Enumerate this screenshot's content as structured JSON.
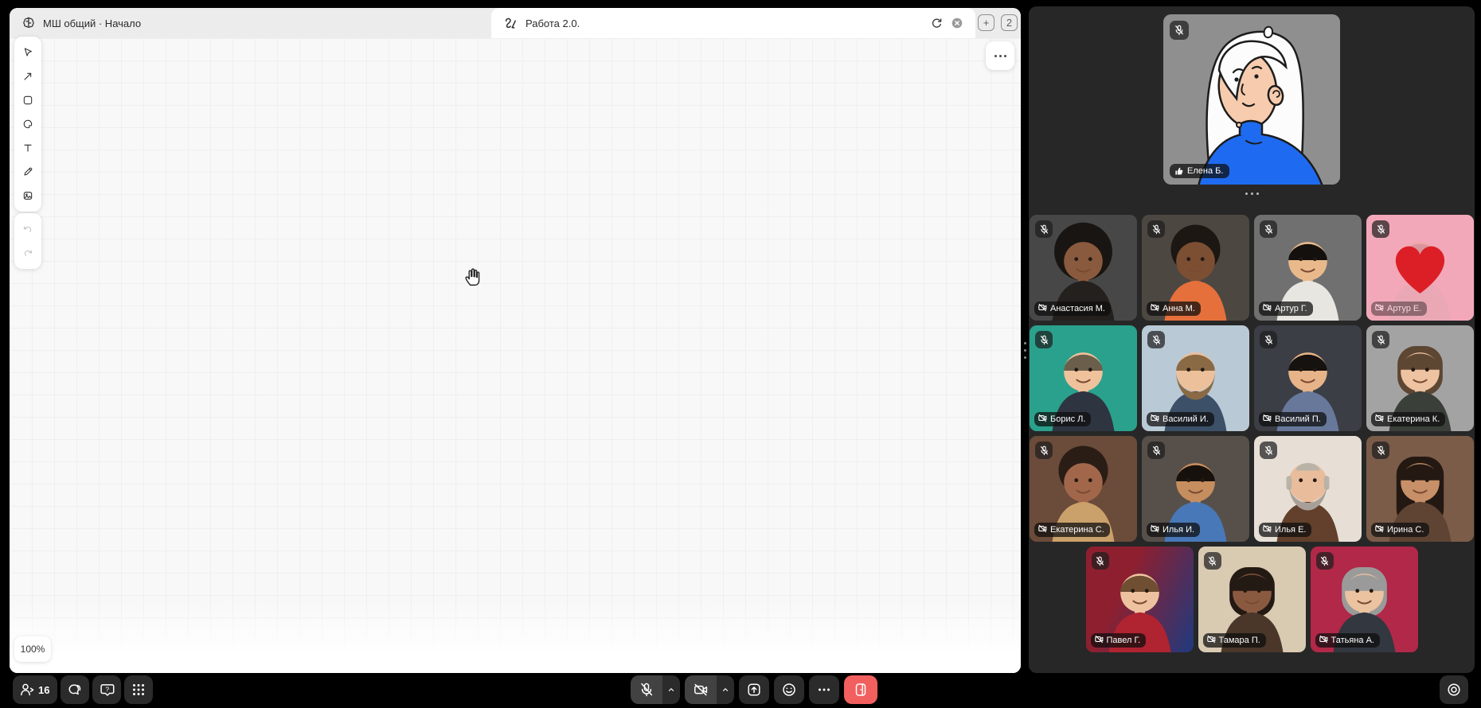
{
  "tab_bar": {
    "tabs": [
      {
        "label": "МШ общий · Начало",
        "icon": "brain-icon",
        "active": false
      },
      {
        "label": "Работа 2.0.",
        "icon": "scribble-icon",
        "active": true
      }
    ],
    "actions": {
      "new_tab_label": "+",
      "window_count_label": "2"
    }
  },
  "whiteboard": {
    "tools": [
      "select",
      "arrow",
      "shape",
      "sticker",
      "text",
      "pen",
      "image"
    ],
    "history": [
      "undo",
      "redo"
    ],
    "zoom_level": "100%"
  },
  "call": {
    "main_speaker": {
      "name": "Елена Б.",
      "mic": "muted",
      "label_icon": "thumbs-up-icon",
      "avatar": {
        "style": "cartoon",
        "bg": "#8f8f8f",
        "hair": "#fcfcfc",
        "skin": "#f7cbae",
        "shirt": "#1e6bf1"
      }
    },
    "participants": [
      {
        "name": "Анастасия М.",
        "mic": "muted",
        "camera": "off",
        "avatar": {
          "bg": "#474747",
          "skin": "#8a5a3e",
          "hair": "#191512",
          "hair_style": "afro",
          "shirt": "#23201e"
        }
      },
      {
        "name": "Анна М.",
        "mic": "muted",
        "camera": "off",
        "avatar": {
          "bg": "#4d4742",
          "skin": "#7c4f33",
          "hair": "#1c1713",
          "hair_style": "curly",
          "shirt": "#e5703c"
        }
      },
      {
        "name": "Артур Г.",
        "mic": "muted",
        "camera": "off",
        "avatar": {
          "bg": "#707070",
          "skin": "#e9b98c",
          "hair": "#14100d",
          "hair_style": "short",
          "shirt": "#e8e6e0"
        }
      },
      {
        "name": "Артур Е.",
        "mic": "muted",
        "camera": "off",
        "reaction": "heart",
        "reaction_color": "#dc1f26",
        "avatar": {
          "bg": "#e9a8b8",
          "skin": "#d9a183",
          "hair": "#8a6a50",
          "hair_style": "short",
          "shirt": "#c9a8a8"
        }
      },
      {
        "name": "Борис Л.",
        "mic": "muted",
        "camera": "off",
        "avatar": {
          "bg": "#2aa18c",
          "skin": "#f0c29c",
          "hair": "#6b5f4c",
          "hair_style": "short",
          "shirt": "#2e3440"
        }
      },
      {
        "name": "Василий И.",
        "mic": "muted",
        "camera": "off",
        "avatar": {
          "bg": "#b9c9d6",
          "skin": "#ecc09a",
          "hair": "#8a6a45",
          "hair_style": "short",
          "beard": "#8a6a45",
          "shirt": "#3c5068"
        }
      },
      {
        "name": "Василий П.",
        "mic": "muted",
        "camera": "off",
        "avatar": {
          "bg": "#3c3e46",
          "skin": "#e6b488",
          "hair": "#16120f",
          "hair_style": "short",
          "shirt": "#67789a"
        }
      },
      {
        "name": "Екатерина К.",
        "mic": "muted",
        "camera": "off",
        "avatar": {
          "bg": "#a3a3a3",
          "skin": "#eec3a2",
          "hair": "#5d4632",
          "hair_style": "bob",
          "shirt": "#3a3f3a"
        }
      },
      {
        "name": "Екатерина С.",
        "mic": "muted",
        "camera": "off",
        "avatar": {
          "bg": "#6b4b39",
          "skin": "#a2674a",
          "hair": "#2a1d16",
          "hair_style": "curly",
          "shirt": "#caa06b"
        }
      },
      {
        "name": "Илья И.",
        "mic": "muted",
        "camera": "off",
        "avatar": {
          "bg": "#57504a",
          "skin": "#c68d5e",
          "hair": "#17110d",
          "hair_style": "short",
          "shirt": "#4878b8"
        }
      },
      {
        "name": "Илья Е.",
        "mic": "muted",
        "camera": "off",
        "avatar": {
          "bg": "#e7dfd6",
          "skin": "#e9bd9c",
          "hair": "#b9b3a8",
          "hair_style": "bald",
          "beard": "#a8a098",
          "shirt": "#63402c"
        }
      },
      {
        "name": "Ирина С.",
        "mic": "muted",
        "camera": "off",
        "avatar": {
          "bg": "#7b5c49",
          "skin": "#c89068",
          "hair": "#241812",
          "hair_style": "long",
          "shirt": "#5f4434"
        }
      },
      {
        "name": "Павел Г.",
        "mic": "muted",
        "camera": "off",
        "avatar": {
          "bg": "#8e1f2f",
          "bg2": "#1f3a7e",
          "skin": "#eec29e",
          "hair": "#6f4e32",
          "hair_style": "short",
          "shirt": "#b02330"
        }
      },
      {
        "name": "Тамара П.",
        "mic": "muted",
        "camera": "off",
        "avatar": {
          "bg": "#d9cab2",
          "skin": "#8a5a40",
          "hair": "#241a14",
          "hair_style": "bob",
          "shirt": "#4a372a"
        }
      },
      {
        "name": "Татьяна А.",
        "mic": "muted",
        "camera": "off",
        "avatar": {
          "bg": "#b12848",
          "skin": "#ecc3a0",
          "hair": "#9a9a9a",
          "hair_style": "bob",
          "shirt": "#33373f"
        }
      }
    ]
  },
  "bottom_bar": {
    "participants_count": "16",
    "buttons_left": [
      "participants",
      "chat",
      "help",
      "apps"
    ],
    "buttons_center": [
      "microphone-muted",
      "mic-options",
      "camera-off",
      "camera-options",
      "share-screen",
      "reactions",
      "more",
      "leave"
    ],
    "buttons_right": [
      "record"
    ],
    "leave_color": "#f15f5f"
  },
  "colors": {
    "panel_bg": "#272727",
    "tab_bar_bg": "#ececec",
    "active_tab_bg": "#ffffff",
    "canvas_bg": "#f8f8f8",
    "accent_blue": "#1e6bf1"
  }
}
